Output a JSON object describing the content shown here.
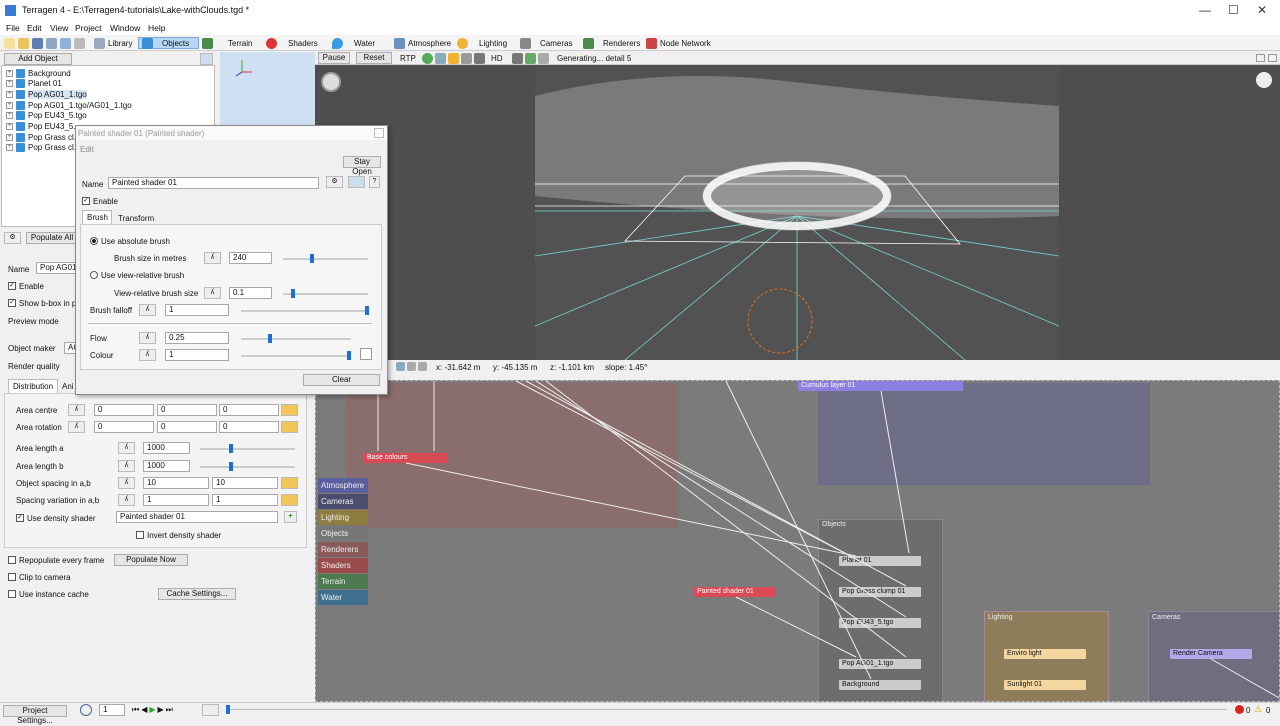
{
  "window": {
    "title": "Terragen 4 - E:\\Terragen4-tutorials\\Lake-withClouds.tgd *"
  },
  "menu": [
    "File",
    "Edit",
    "View",
    "Project",
    "Window",
    "Help"
  ],
  "toolbar": {
    "library": "Library",
    "objects": "Objects",
    "terrain": "Terrain",
    "shaders": "Shaders",
    "water": "Water",
    "atmosphere": "Atmosphere",
    "lighting": "Lighting",
    "cameras": "Cameras",
    "renderers": "Renderers",
    "node_network": "Node Network"
  },
  "left": {
    "add_object": "Add Object",
    "tree": [
      "Background",
      "Planet 01",
      "Pop AG01_1.tgo",
      "Pop AG01_1.tgo/AG01_1.tgo",
      "Pop EU43_5.tgo",
      "Pop EU43_5...",
      "Pop Grass cl...",
      "Pop Grass cl..."
    ],
    "populate_all": "Populate All",
    "name_label": "Name",
    "name_value": "Pop AG01_...",
    "enable": "Enable",
    "show_bbox": "Show b-box in p",
    "preview_mode": "Preview mode",
    "object_maker": "Object maker",
    "object_maker_value": "AG",
    "render_quality": "Render quality",
    "tab_distribution": "Distribution",
    "tab_ani": "Ani",
    "area_centre": "Area centre",
    "area_centre_vals": [
      "0",
      "0",
      "0"
    ],
    "area_rotation": "Area rotation",
    "area_rotation_vals": [
      "0",
      "0",
      "0"
    ],
    "area_length_a": "Area length a",
    "area_length_a_val": "1000",
    "area_length_b": "Area length b",
    "area_length_b_val": "1000",
    "spacing": "Object spacing in a,b",
    "spacing_vals": [
      "10",
      "10"
    ],
    "spacing_var": "Spacing variation in a,b",
    "spacing_var_vals": [
      "1",
      "1"
    ],
    "use_density": "Use density shader",
    "density_value": "Painted shader 01",
    "invert_density": "Invert density shader",
    "repopulate": "Repopulate every frame",
    "populate_now": "Populate Now",
    "clip_camera": "Clip to camera",
    "instance_cache": "Use instance cache",
    "cache_settings": "Cache Settings..."
  },
  "dialog": {
    "title": "Painted shader 01   (Painted shader)",
    "edit": "Edit",
    "stay_open": "Stay Open",
    "name_label": "Name",
    "name_value": "Painted shader 01",
    "enable": "Enable",
    "tab_brush": "Brush",
    "tab_transform": "Transform",
    "use_absolute": "Use absolute brush",
    "brush_size_label": "Brush size in metres",
    "brush_size": "240",
    "use_view_relative": "Use view-relative brush",
    "view_rel_label": "View-relative brush size",
    "view_rel": "0.1",
    "falloff_label": "Brush falloff",
    "falloff": "1",
    "flow_label": "Flow",
    "flow": "0.25",
    "colour_label": "Colour",
    "colour": "1",
    "clear": "Clear",
    "sliders": {
      "brush_size": 0.33,
      "view_rel": 0.1,
      "falloff": 1.0,
      "flow": 0.25,
      "colour": 1.0
    }
  },
  "viewport": {
    "pause": "Pause",
    "reset": "Reset",
    "rtp": "RTP",
    "hd": "HD",
    "status": "Generating... detail 5"
  },
  "coords": {
    "x": "x: -31.642 m",
    "y": "y: -45.135 m",
    "z": "z: -1.101 km",
    "slope": "slope: 1.45°"
  },
  "network": {
    "tabs": [
      "Atmosphere",
      "Cameras",
      "Lighting",
      "Objects",
      "Renderers",
      "Shaders",
      "Terrain",
      "Water"
    ],
    "tab_colors": [
      "#5a5fa0",
      "#4a4d6e",
      "#8d7d3e",
      "#777",
      "#8a5a5a",
      "#9a4b4b",
      "#4f7a4f",
      "#3f6f8f"
    ],
    "cumulus": "Cumulus layer 01",
    "base_colours": "Base colours",
    "painted": "Painted shader 01",
    "objects_group": "Objects",
    "lighting_group": "Lighting",
    "cameras_group": "Cameras",
    "obj_nodes": [
      "Planet 01",
      "Pop Grass clump 01",
      "Pop EU43_5.tgo",
      "Pop AG01_1.tgo",
      "Background"
    ],
    "enviro": "Enviro light",
    "sunlight": "Sunlight 01",
    "render_camera": "Render Camera"
  },
  "status": {
    "project_settings": "Project Settings...",
    "frame": "1",
    "errors": "0",
    "warnings": "0"
  }
}
